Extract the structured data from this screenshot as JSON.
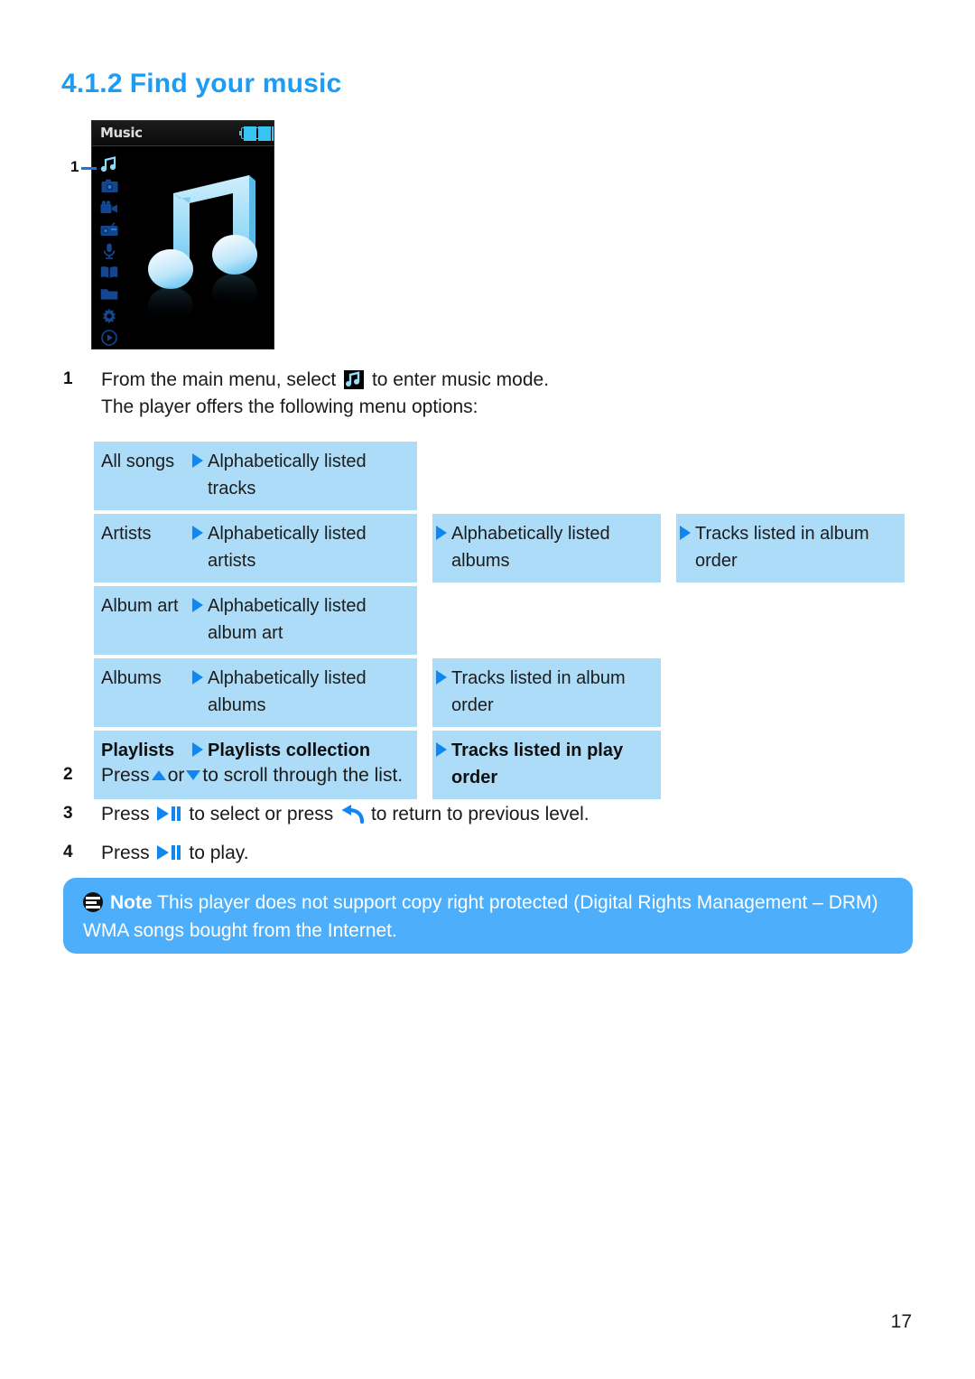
{
  "heading": {
    "number": "4.1.2",
    "title": "Find your music"
  },
  "device": {
    "screen_title": "Music",
    "battery_icon": "battery-full-icon",
    "battery_bars": 4,
    "callout_label": "1",
    "main_art": "music-note-3d-icon",
    "rail_icons": [
      {
        "name": "music-icon",
        "selected": true
      },
      {
        "name": "camera-icon",
        "selected": false
      },
      {
        "name": "video-camera-icon",
        "selected": false
      },
      {
        "name": "radio-icon",
        "selected": false
      },
      {
        "name": "microphone-icon",
        "selected": false
      },
      {
        "name": "book-icon",
        "selected": false
      },
      {
        "name": "folder-icon",
        "selected": false
      },
      {
        "name": "settings-gear-icon",
        "selected": false
      },
      {
        "name": "now-playing-icon",
        "selected": false
      }
    ]
  },
  "steps": {
    "one": {
      "num": "1",
      "text_before": "From the main menu, select",
      "icon": "music-icon",
      "text_after": "to enter music mode.",
      "line2": "The player offers the following menu options:"
    },
    "two": {
      "num": "2",
      "text_before": "Press",
      "icon_up": "triangle-up-icon",
      "text_mid": "or",
      "icon_down": "triangle-down-icon",
      "text_after": "to scroll through the list."
    },
    "three": {
      "num": "3",
      "text_before": "Press",
      "icon_play": "play-pause-icon",
      "text_mid": "to select or press",
      "icon_return": "return-arrow-icon",
      "text_after": "to return to previous level."
    },
    "four": {
      "num": "4",
      "text_before": "Press",
      "icon_play": "play-pause-icon",
      "text_after": "to play."
    }
  },
  "menu_table": {
    "rows": [
      {
        "bold": false,
        "cells": [
          "All songs",
          "Alphabetically listed tracks"
        ]
      },
      {
        "bold": false,
        "cells": [
          "Artists",
          "Alphabetically listed artists",
          "Alphabetically listed albums",
          "Tracks listed in album order"
        ]
      },
      {
        "bold": false,
        "cells": [
          "Album art",
          "Alphabetically listed album art"
        ]
      },
      {
        "bold": false,
        "cells": [
          "Albums",
          "Alphabetically listed albums",
          "Tracks listed in album order"
        ]
      },
      {
        "bold": true,
        "cells": [
          "Playlists",
          "Playlists collection",
          "Tracks listed in play order"
        ]
      }
    ]
  },
  "note": {
    "icon": "note-info-icon",
    "label": "Note",
    "text": "This player does not support copy right protected (Digital Rights Management – DRM) WMA songs bought from the Internet."
  },
  "page_number": "17",
  "colors": {
    "heading_blue": "#1B9CF5",
    "cell_blue": "#ACDCF8",
    "arrow_blue": "#1286F0",
    "note_blue": "#4DAFFB"
  }
}
